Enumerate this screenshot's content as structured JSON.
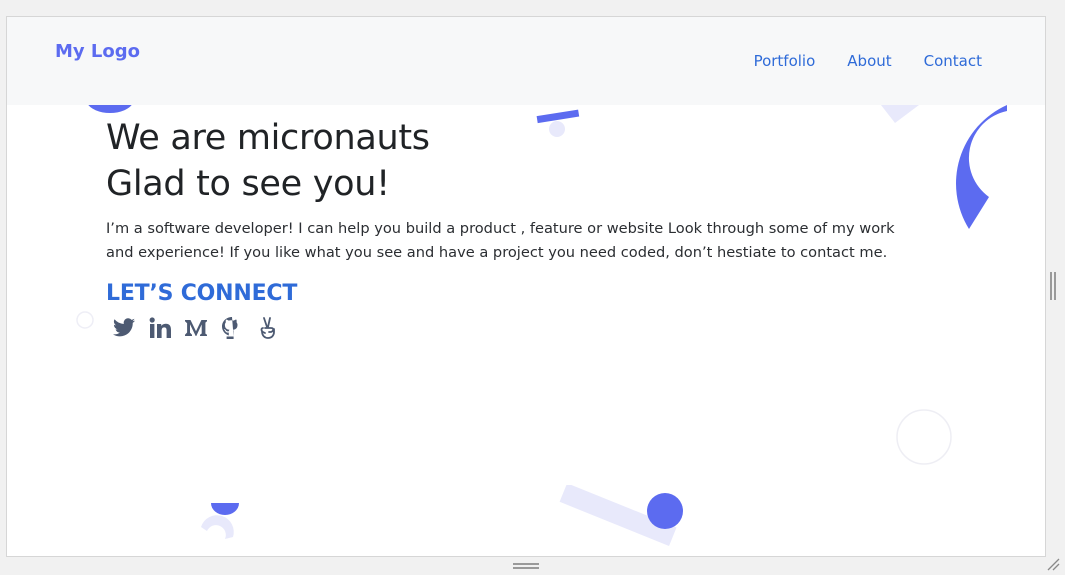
{
  "navbar": {
    "logo": "My Logo",
    "links": [
      {
        "label": "Portfolio"
      },
      {
        "label": "About"
      },
      {
        "label": "Contact"
      }
    ]
  },
  "hero": {
    "headline_line1": "We are micronauts",
    "headline_line2": "Glad to see you!",
    "intro": "I’m a software developer! I can help you build a product , feature or website Look through some of my work and experience! If you like what you see and have a project you need coded, don’t hestiate to contact me.",
    "connect_heading": "LET’S CONNECT",
    "socials": [
      {
        "icon": "twitter-icon"
      },
      {
        "icon": "linkedin-icon"
      },
      {
        "icon": "medium-icon"
      },
      {
        "icon": "github-icon"
      },
      {
        "icon": "angellist-icon"
      }
    ]
  },
  "colors": {
    "accent": "#5c6bf0",
    "link": "#2f6bd8",
    "icon": "#4d5a72",
    "pale_shape": "#e8e9fb",
    "navbar_bg": "#f7f8f9"
  }
}
